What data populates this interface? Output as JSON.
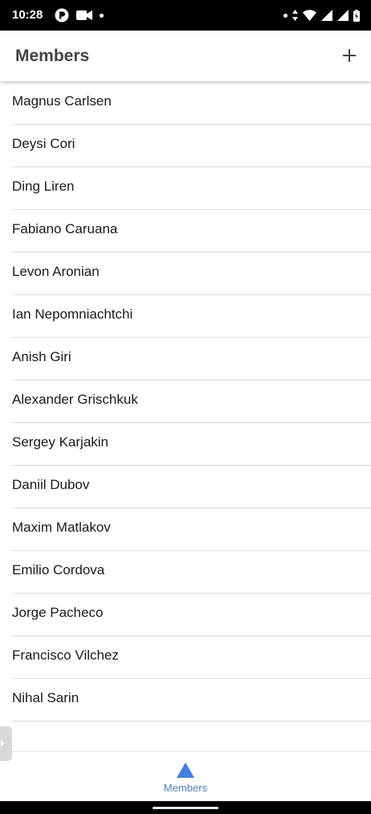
{
  "status_bar": {
    "time": "10:28",
    "left_icons": [
      "app-notification-icon",
      "video-camera-icon",
      "dot-icon"
    ],
    "right_icons": [
      "dot-icon",
      "data-arrows-icon",
      "wifi-icon",
      "signal-icon",
      "signal-icon",
      "battery-icon"
    ]
  },
  "app_bar": {
    "title": "Members",
    "action_icon": "plus-icon"
  },
  "members": [
    "Magnus Carlsen",
    "Deysi Cori",
    "Ding Liren",
    "Fabiano Caruana",
    "Levon Aronian",
    "Ian Nepomniachtchi",
    "Anish Giri",
    "Alexander Grischkuk",
    "Sergey Karjakin",
    "Daniil Dubov",
    "Maxim Matlakov",
    "Emilio Cordova",
    "Jorge Pacheco",
    "Francisco Vilchez",
    "Nihal Sarin",
    ""
  ],
  "bottom_nav": {
    "tabs": [
      {
        "label": "Members",
        "icon": "triangle-icon",
        "active": true
      }
    ]
  },
  "colors": {
    "accent": "#4a7fd6",
    "nav_icon": "#3f7ee8",
    "title": "#444444",
    "divider": "#dcdcdc"
  }
}
